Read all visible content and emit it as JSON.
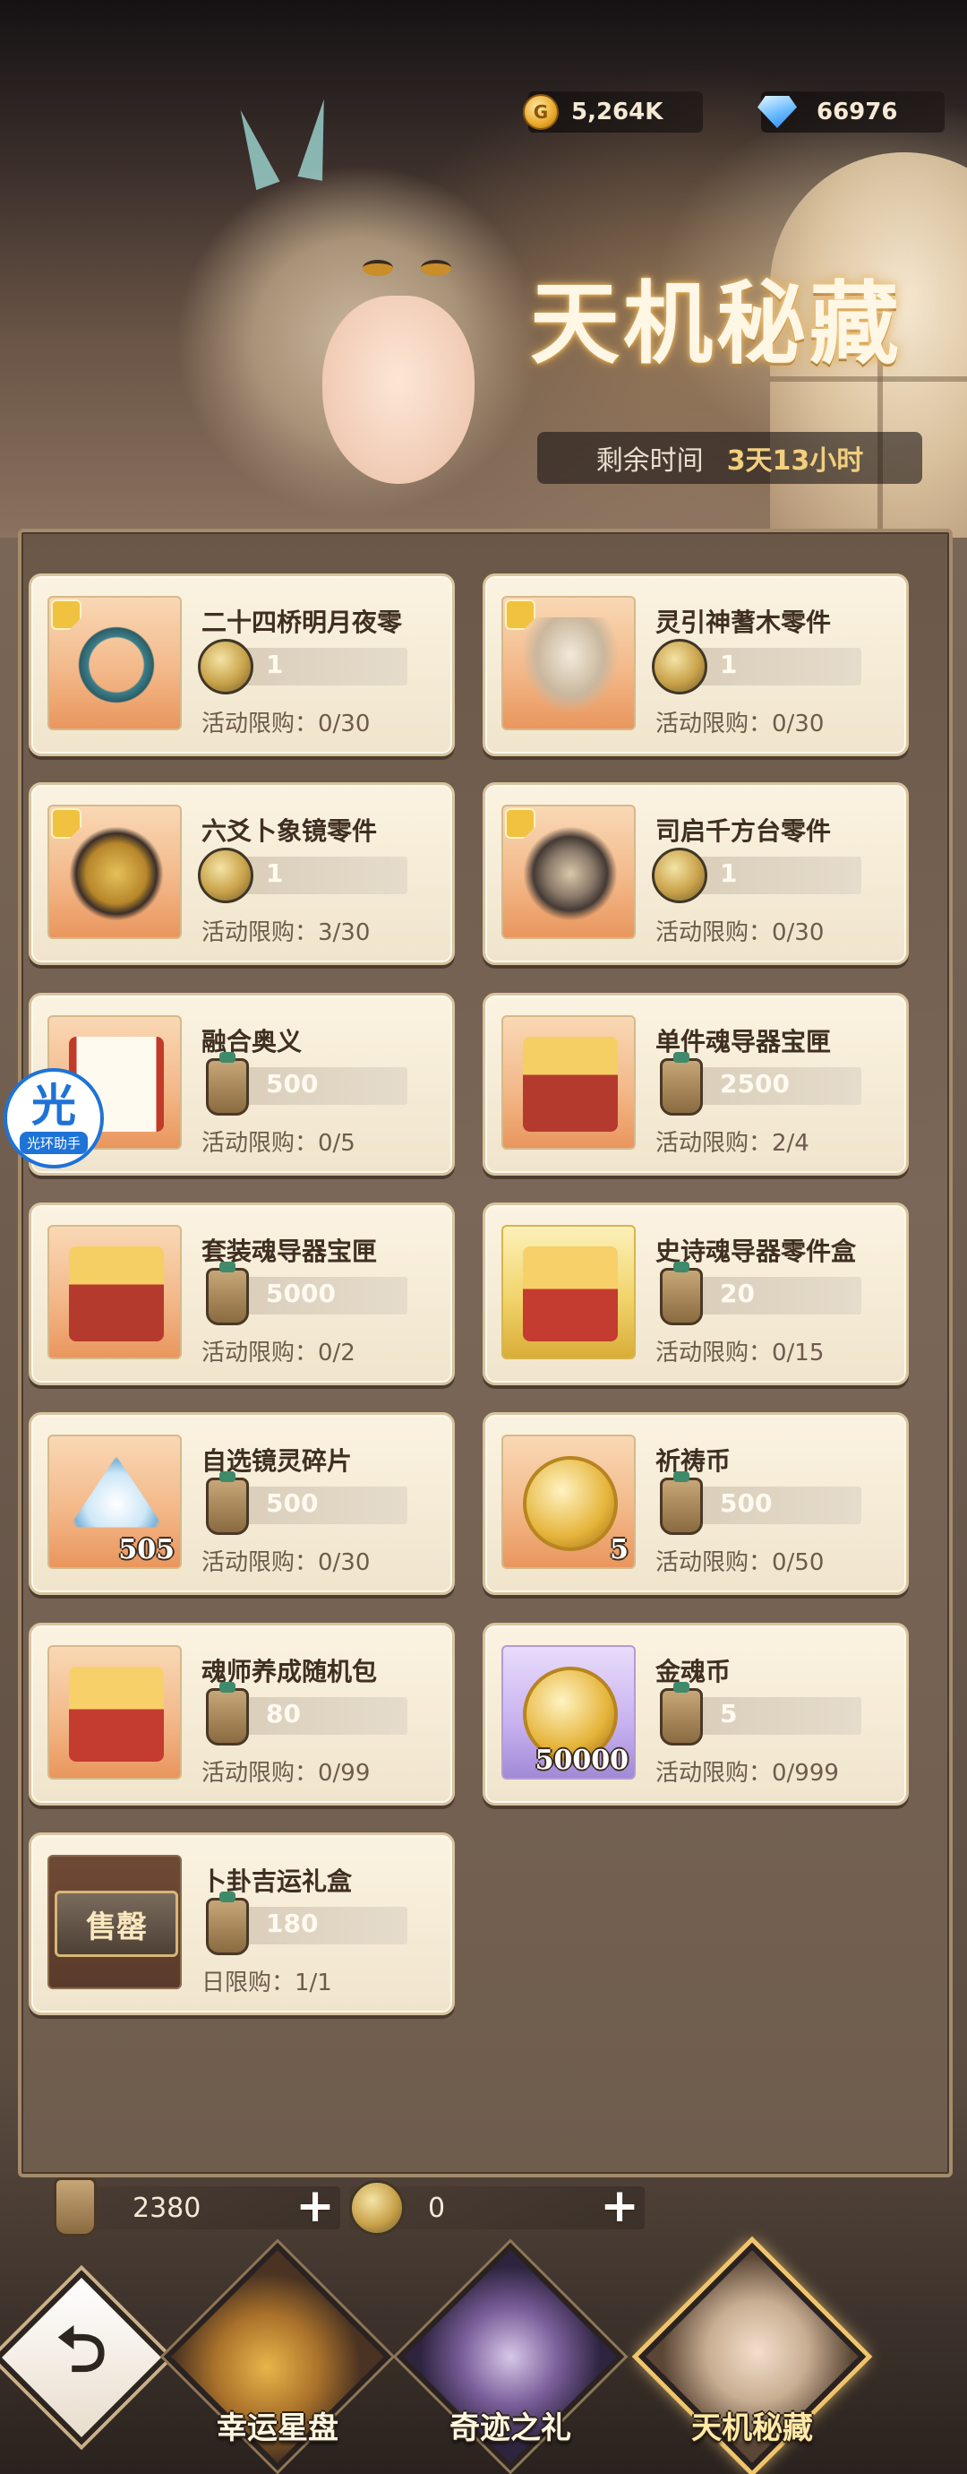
{
  "header": {
    "coin_value": "5,264K",
    "gem_value": "66976",
    "title": "天机秘藏",
    "timer_label": "剩余时间",
    "timer_value": "3天13小时"
  },
  "helper": {
    "icon_text": "光",
    "label": "光环助手"
  },
  "items": [
    {
      "name": "二十四桥明月夜零",
      "price": "1",
      "limit": "活动限购：0/30",
      "currency": "coin",
      "piece": true,
      "art": "ring"
    },
    {
      "name": "灵引神蓍木零件",
      "price": "1",
      "limit": "活动限购：0/30",
      "currency": "coin",
      "piece": true,
      "art": "tree"
    },
    {
      "name": "六爻卜象镜零件",
      "price": "1",
      "limit": "活动限购：3/30",
      "currency": "coin",
      "piece": true,
      "art": "mirror"
    },
    {
      "name": "司启千方台零件",
      "price": "1",
      "limit": "活动限购：0/30",
      "currency": "coin",
      "piece": true,
      "art": "orb"
    },
    {
      "name": "融合奥义",
      "price": "500",
      "limit": "活动限购：0/5",
      "currency": "token",
      "piece": false,
      "art": "scroll"
    },
    {
      "name": "单件魂导器宝匣",
      "price": "2500",
      "limit": "活动限购：2/4",
      "currency": "token",
      "piece": false,
      "art": "chest"
    },
    {
      "name": "套装魂导器宝匣",
      "price": "5000",
      "limit": "活动限购：0/2",
      "currency": "token",
      "piece": false,
      "art": "chest"
    },
    {
      "name": "史诗魂导器零件盒",
      "price": "20",
      "limit": "活动限购：0/15",
      "currency": "token",
      "piece": false,
      "art": "gbox"
    },
    {
      "name": "自选镜灵碎片",
      "price": "500",
      "limit": "活动限购：0/30",
      "currency": "token",
      "piece": false,
      "art": "crystal",
      "qty": "505"
    },
    {
      "name": "祈祷币",
      "price": "500",
      "limit": "活动限购：0/50",
      "currency": "token",
      "piece": false,
      "art": "coin",
      "qty": "5"
    },
    {
      "name": "魂师养成随机包",
      "price": "80",
      "limit": "活动限购：0/99",
      "currency": "token",
      "piece": false,
      "art": "gbox"
    },
    {
      "name": "金魂币",
      "price": "5",
      "limit": "活动限购：0/999",
      "currency": "token",
      "piece": false,
      "art": "coin",
      "qty": "50000"
    },
    {
      "name": "卜卦吉运礼盒",
      "price": "180",
      "limit": "日限购：1/1",
      "currency": "token",
      "piece": false,
      "art": "sold",
      "sold_text": "售罄"
    }
  ],
  "bottom": {
    "token_amount": "2380",
    "coin_amount": "0",
    "plus": "+"
  },
  "nav": {
    "back_icon": "⮌",
    "tabs": [
      {
        "label": "幸运星盘"
      },
      {
        "label": "奇迹之礼"
      },
      {
        "label": "天机秘藏",
        "active": true
      }
    ]
  },
  "colors": {
    "accent_gold": "#f0c46a",
    "helper_blue": "#1e73d6"
  }
}
